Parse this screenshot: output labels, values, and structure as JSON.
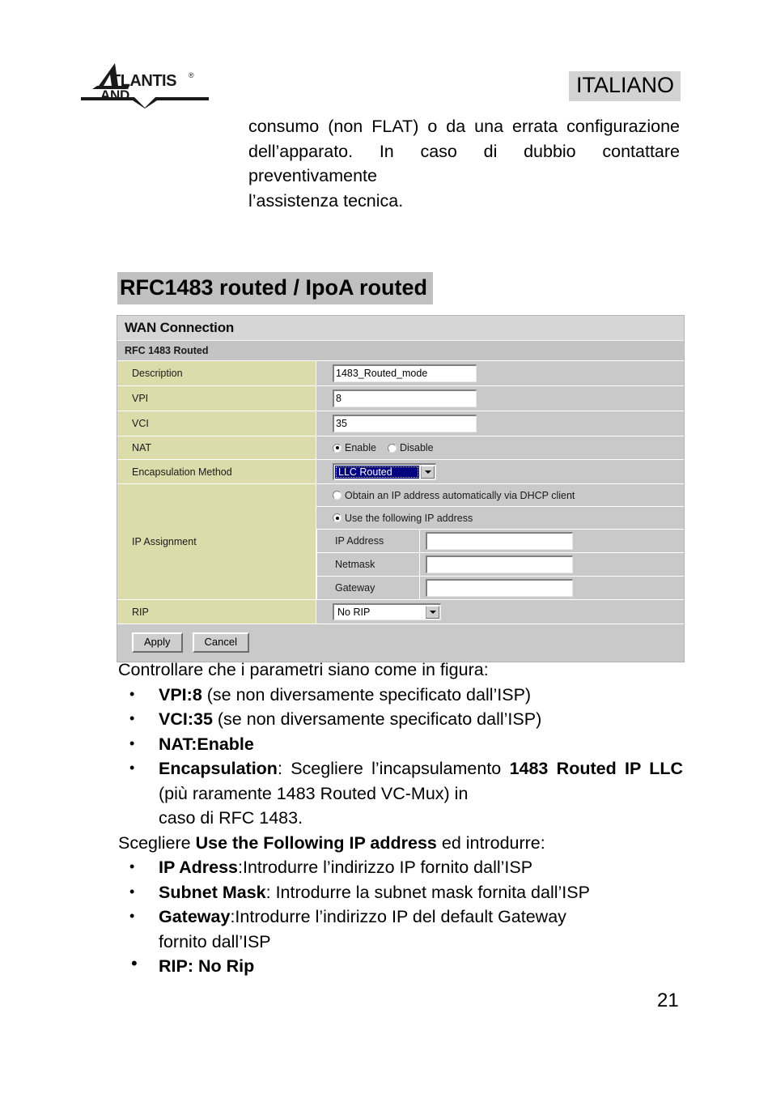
{
  "header": {
    "language_badge": "ITALIANO",
    "logo_text_primary": "ATLANTIS",
    "logo_text_secondary": "LAND",
    "logo_registered_mark": "®"
  },
  "intro": {
    "text": "consumo (non FLAT) o da una errata configurazione dell’apparato. In caso di dubbio contattare preventivamente",
    "last_line": "l’assistenza tecnica."
  },
  "section": {
    "title": "RFC1483 routed / IpoA routed"
  },
  "router_ui": {
    "title": "WAN Connection",
    "subtitle": "RFC 1483 Routed",
    "fields": {
      "description_label": "Description",
      "description_value": "1483_Routed_mode",
      "vpi_label": "VPI",
      "vpi_value": "8",
      "vci_label": "VCI",
      "vci_value": "35",
      "nat_label": "NAT",
      "nat_enable": "Enable",
      "nat_disable": "Disable",
      "encapsulation_label": "Encapsulation Method",
      "encapsulation_value": "LLC Routed",
      "ip_assignment_label": "IP Assignment",
      "radio_dhcp": "Obtain an IP address automatically via DHCP client",
      "radio_static": "Use the following IP address",
      "ip_address_label": "IP Address",
      "ip_address_value": "",
      "netmask_label": "Netmask",
      "netmask_value": "",
      "gateway_label": "Gateway",
      "gateway_value": "",
      "rip_label": "RIP",
      "rip_value": "No RIP"
    },
    "buttons": {
      "apply": "Apply",
      "cancel": "Cancel"
    },
    "colors": {
      "label_column": "#dcdcaa",
      "panel": "#c9c9c9",
      "title_bar": "#d6d6d6",
      "subtitle_bar": "#c4c4c4",
      "select_highlight": "#000080"
    }
  },
  "body": {
    "intro_line": "Controllare che i parametri siano come in figura:",
    "bullets_1": [
      {
        "bold": "VPI:8",
        "rest": " (se non diversamente specificato dall’ISP)"
      },
      {
        "bold": "VCI",
        "rest_bold": ":35",
        "rest": " (se non diversamente specificato dall’ISP)"
      },
      {
        "bold": "NAT:Enable",
        "rest": ""
      }
    ],
    "encapsulation_bullet": {
      "bold_lead": "Encapsulation",
      "mid": ": Scegliere l’incapsulamento ",
      "bold_value": "1483 Routed IP LLC",
      "rest": " (più raramente 1483 Routed VC-Mux) in",
      "tail": "caso di RFC 1483."
    },
    "choose_line": {
      "lead": "Scegliere ",
      "bold": "Use the Following IP address",
      "rest": " ed introdurre:"
    },
    "bullets_2": [
      {
        "bold": "IP Adress",
        "rest": ":Introdurre l’indirizzo IP fornito dall’ISP"
      },
      {
        "bold": "Subnet Mask",
        "rest": ": Introdurre la subnet mask fornita dall’ISP"
      },
      {
        "bold": "Gateway",
        "rest": ":Introdurre l’indirizzo IP del default Gateway",
        "tail": "fornito dall’ISP"
      },
      {
        "bold": "RIP: No Rip",
        "rest": ""
      }
    ]
  },
  "footer": {
    "page_number": "21"
  }
}
